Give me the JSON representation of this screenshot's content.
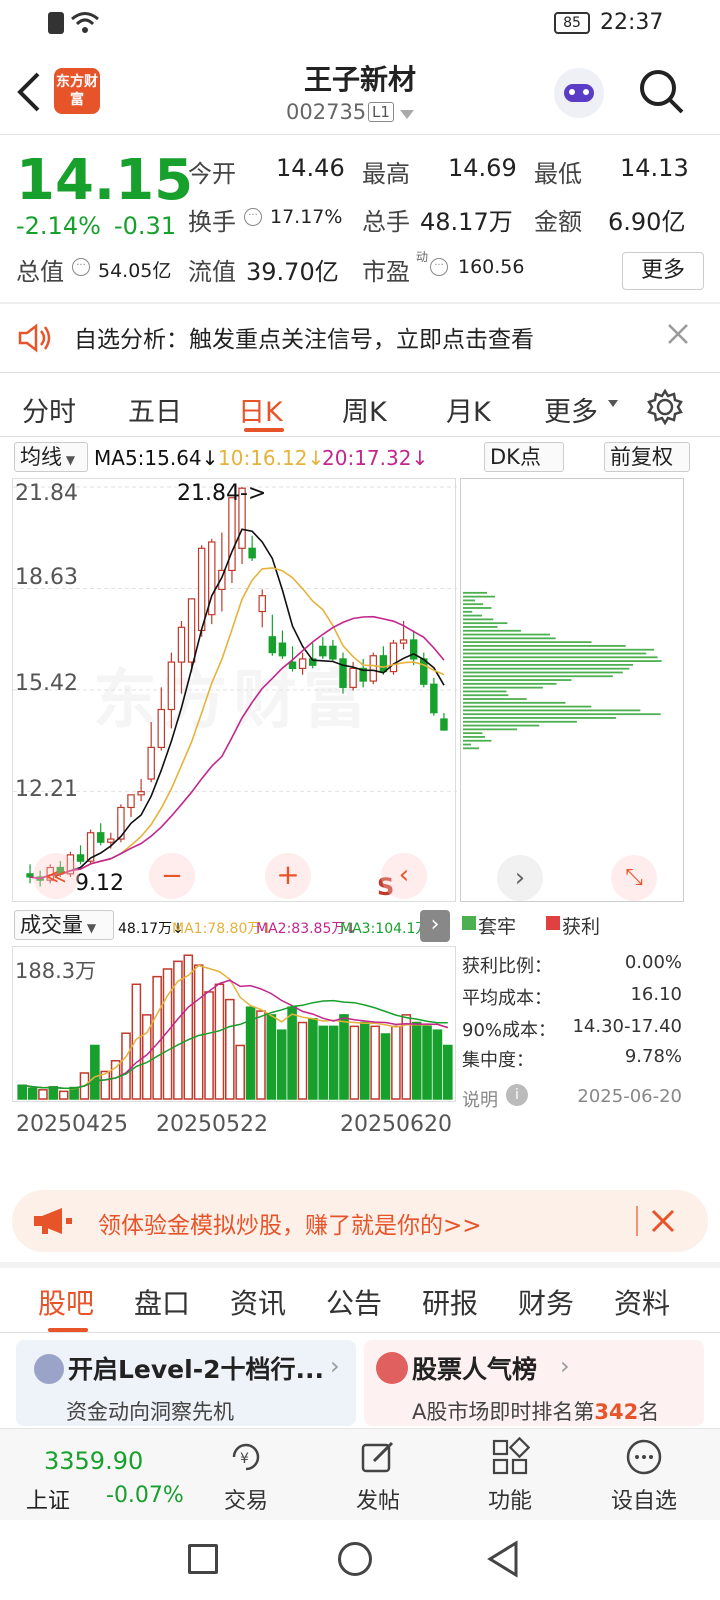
{
  "status_bar": {
    "battery": "85",
    "time": "22:37"
  },
  "header": {
    "logo_text": "东方财富",
    "title": "王子新材",
    "code": "002735",
    "level_badge": "L1"
  },
  "quote": {
    "price": "14.15",
    "change_pct": "-2.14%",
    "change": "-0.31",
    "open_label": "今开",
    "open": "14.46",
    "high_label": "最高",
    "high": "14.69",
    "low_label": "最低",
    "low": "14.13",
    "turnover_label": "换手",
    "turnover": "17.17%",
    "volume_label": "总手",
    "volume": "48.17万",
    "amount_label": "金额",
    "amount": "6.90亿",
    "mktcap_label": "总值",
    "mktcap": "54.05亿",
    "float_label": "流值",
    "float_cap": "39.70亿",
    "pe_label": "市盈",
    "pe_sup": "动",
    "pe": "160.56",
    "more_label": "更多"
  },
  "notice": {
    "text": "自选分析：触发重点关注信号，立即点击查看"
  },
  "chart_tabs": [
    "分时",
    "五日",
    "日K",
    "周K",
    "月K",
    "更多"
  ],
  "chart_tab_active": "日K",
  "chart_toolbar": {
    "ma_select": "均线",
    "ma5": "MA5:15.64↓",
    "ma10": "10:16.12↓",
    "ma20": "20:17.32↓",
    "dk_label": "DK点",
    "adjust_label": "前复权"
  },
  "kline": {
    "y_ticks": [
      "21.84",
      "18.63",
      "15.42",
      "12.21"
    ],
    "max_marker": "21.84->",
    "min_marker": "9.12",
    "s_marker": "S",
    "watermark": "东方财富"
  },
  "volume_panel": {
    "select_label": "成交量",
    "vol": "48.17万↓",
    "ma1": "MA1:78.80万↓",
    "ma2": "MA2:83.85万↓",
    "ma3": "MA3:104.1万↓",
    "max_label": "188.3万",
    "x_ticks": [
      "20250425",
      "20250522",
      "20250620"
    ]
  },
  "chip_panel": {
    "legend_trapped": "套牢",
    "legend_profit": "获利",
    "stats": [
      {
        "label": "获利比例：",
        "value": "0.00%"
      },
      {
        "label": "平均成本：",
        "value": "16.10"
      },
      {
        "label": "90%成本：",
        "value": "14.30-17.40"
      },
      {
        "label": "集中度：",
        "value": "9.78%"
      }
    ],
    "note_label": "说明",
    "date": "2025-06-20"
  },
  "promo": {
    "text": "领体验金模拟炒股，赚了就是你的>>"
  },
  "bottom_tabs": [
    "股吧",
    "盘口",
    "资讯",
    "公告",
    "研报",
    "财务",
    "资料"
  ],
  "bottom_tab_active": "股吧",
  "cards": [
    {
      "title": "开启Level-2十档行...",
      "sub": "资金动向洞察先机"
    },
    {
      "title": "股票人气榜",
      "sub_prefix": "A股市场即时排名第",
      "rank": "342",
      "sub_suffix": "名"
    }
  ],
  "dock": {
    "index_value": "3359.90",
    "index_name": "上证",
    "index_change": "-0.07%",
    "items": [
      "交易",
      "发帖",
      "功能",
      "设自选"
    ]
  },
  "colors": {
    "up": "#c0392b",
    "down": "#17a02c",
    "accent": "#e8542a",
    "ma5": "#111111",
    "ma10": "#e6b23a",
    "ma20": "#c2268f"
  },
  "candles": [
    {
      "o": 9.6,
      "h": 9.9,
      "l": 9.3,
      "c": 9.5
    },
    {
      "o": 9.5,
      "h": 9.7,
      "l": 9.2,
      "c": 9.4
    },
    {
      "o": 9.4,
      "h": 9.9,
      "l": 9.3,
      "c": 9.8
    },
    {
      "o": 9.8,
      "h": 10.0,
      "l": 9.5,
      "c": 9.6
    },
    {
      "o": 9.6,
      "h": 10.3,
      "l": 9.5,
      "c": 10.2
    },
    {
      "o": 10.2,
      "h": 10.5,
      "l": 9.9,
      "c": 10.0
    },
    {
      "o": 10.0,
      "h": 11.0,
      "l": 9.9,
      "c": 10.9
    },
    {
      "o": 10.9,
      "h": 11.2,
      "l": 10.5,
      "c": 10.6
    },
    {
      "o": 10.6,
      "h": 10.9,
      "l": 10.4,
      "c": 10.7
    },
    {
      "o": 10.7,
      "h": 11.8,
      "l": 10.6,
      "c": 11.7
    },
    {
      "o": 11.7,
      "h": 12.1,
      "l": 11.4,
      "c": 12.1
    },
    {
      "o": 12.1,
      "h": 12.6,
      "l": 11.9,
      "c": 12.2
    },
    {
      "o": 12.6,
      "h": 14.4,
      "l": 12.5,
      "c": 13.6
    },
    {
      "o": 13.6,
      "h": 15.5,
      "l": 13.5,
      "c": 14.8
    },
    {
      "o": 14.8,
      "h": 16.6,
      "l": 14.2,
      "c": 16.3
    },
    {
      "o": 16.3,
      "h": 17.6,
      "l": 15.3,
      "c": 17.4
    },
    {
      "o": 16.3,
      "h": 18.3,
      "l": 16.0,
      "c": 18.3
    },
    {
      "o": 17.3,
      "h": 20.0,
      "l": 17.1,
      "c": 19.9
    },
    {
      "o": 17.8,
      "h": 20.2,
      "l": 17.5,
      "c": 20.1
    },
    {
      "o": 18.6,
      "h": 20.4,
      "l": 17.9,
      "c": 19.2
    },
    {
      "o": 19.2,
      "h": 21.5,
      "l": 18.8,
      "c": 21.5
    },
    {
      "o": 19.9,
      "h": 21.84,
      "l": 19.4,
      "c": 21.8
    },
    {
      "o": 19.9,
      "h": 20.3,
      "l": 19.5,
      "c": 19.6
    },
    {
      "o": 17.9,
      "h": 18.6,
      "l": 17.4,
      "c": 18.4
    },
    {
      "o": 17.1,
      "h": 17.8,
      "l": 16.5,
      "c": 16.6
    },
    {
      "o": 16.9,
      "h": 17.3,
      "l": 16.4,
      "c": 16.5
    },
    {
      "o": 16.3,
      "h": 16.8,
      "l": 16.0,
      "c": 16.1
    },
    {
      "o": 16.1,
      "h": 16.6,
      "l": 15.9,
      "c": 16.4
    },
    {
      "o": 16.4,
      "h": 16.9,
      "l": 16.1,
      "c": 16.2
    },
    {
      "o": 16.8,
      "h": 17.1,
      "l": 16.4,
      "c": 16.5
    },
    {
      "o": 16.8,
      "h": 17.0,
      "l": 16.3,
      "c": 16.4
    },
    {
      "o": 16.4,
      "h": 16.6,
      "l": 15.3,
      "c": 15.5
    },
    {
      "o": 15.5,
      "h": 16.3,
      "l": 15.4,
      "c": 16.1
    },
    {
      "o": 16.1,
      "h": 16.4,
      "l": 15.5,
      "c": 15.7
    },
    {
      "o": 15.7,
      "h": 16.6,
      "l": 15.6,
      "c": 16.5
    },
    {
      "o": 16.5,
      "h": 16.8,
      "l": 15.9,
      "c": 16.0
    },
    {
      "o": 16.0,
      "h": 17.0,
      "l": 15.9,
      "c": 16.9
    },
    {
      "o": 16.9,
      "h": 17.6,
      "l": 16.7,
      "c": 17.0
    },
    {
      "o": 17.0,
      "h": 17.3,
      "l": 16.2,
      "c": 16.4
    },
    {
      "o": 16.4,
      "h": 16.6,
      "l": 15.5,
      "c": 15.6
    },
    {
      "o": 15.6,
      "h": 15.8,
      "l": 14.6,
      "c": 14.7
    },
    {
      "o": 14.5,
      "h": 14.69,
      "l": 14.13,
      "c": 14.15
    }
  ],
  "volumes": [
    18,
    14,
    12,
    16,
    10,
    15,
    34,
    70,
    36,
    50,
    86,
    150,
    110,
    160,
    170,
    180,
    188,
    175,
    140,
    150,
    130,
    70,
    120,
    115,
    110,
    90,
    120,
    100,
    105,
    95,
    95,
    110,
    95,
    100,
    95,
    85,
    95,
    110,
    100,
    95,
    90,
    70
  ]
}
